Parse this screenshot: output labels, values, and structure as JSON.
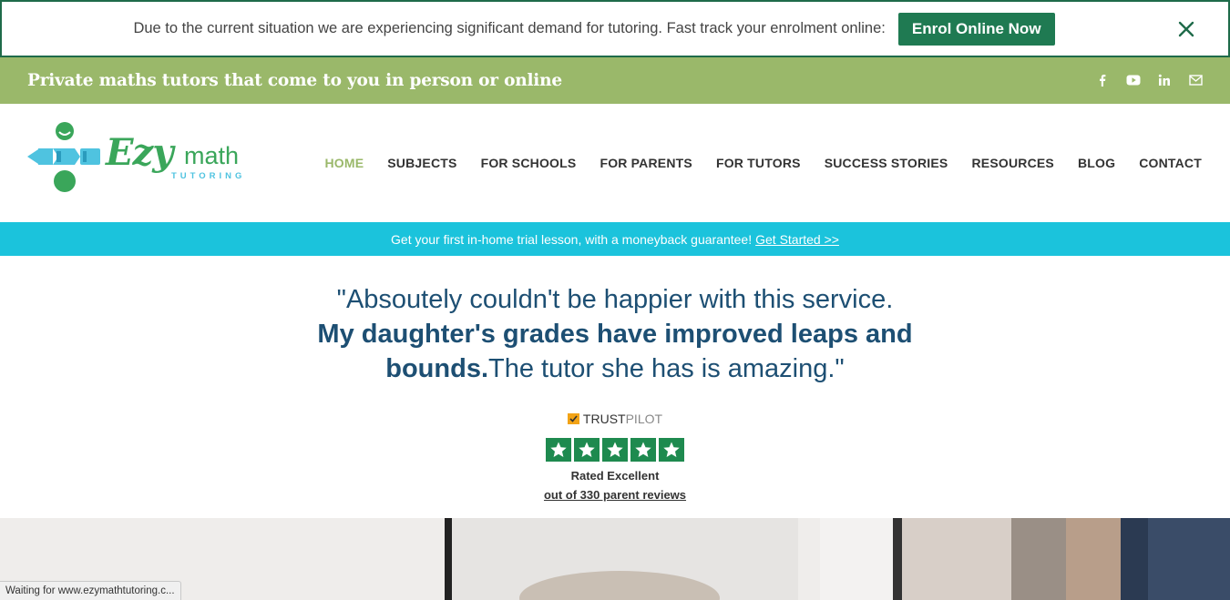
{
  "announcement": {
    "text": "Due to the current situation we are experiencing significant demand for tutoring. Fast track your enrolment online:",
    "button": "Enrol Online Now",
    "close_icon": "close-icon"
  },
  "tagline": {
    "text": "Private maths tutors that come to you in person or online",
    "social_icons": [
      "facebook-icon",
      "youtube-icon",
      "linkedin-icon",
      "mail-icon"
    ]
  },
  "logo": {
    "word": "Ezy",
    "word2": "math",
    "sub": "TUTORING"
  },
  "nav": {
    "items": [
      {
        "label": "HOME",
        "active": true
      },
      {
        "label": "SUBJECTS"
      },
      {
        "label": "FOR SCHOOLS"
      },
      {
        "label": "FOR PARENTS"
      },
      {
        "label": "FOR TUTORS"
      },
      {
        "label": "SUCCESS STORIES"
      },
      {
        "label": "RESOURCES"
      },
      {
        "label": "BLOG"
      },
      {
        "label": "CONTACT"
      }
    ]
  },
  "promo": {
    "text": "Get your first in-home trial lesson, with a moneyback guarantee!",
    "link": "Get Started >>"
  },
  "testimonial": {
    "line1": "\"Absoutely couldn't be happier with this service.",
    "line2_bold": "My daughter's grades have improved leaps and",
    "line3_bold": "bounds.",
    "line3_rest": "The tutor she has is amazing.\""
  },
  "trustpilot": {
    "brand_a": "TRUST",
    "brand_b": "PILOT",
    "stars": 5,
    "rated": "Rated Excellent",
    "reviews": "out of 330 parent reviews"
  },
  "status": {
    "text": "Waiting for www.ezymathtutoring.c..."
  },
  "colors": {
    "accent_green": "#1f7a52",
    "olive": "#9ab86a",
    "cyan": "#1bc3dc",
    "navy": "#1d4f73"
  }
}
